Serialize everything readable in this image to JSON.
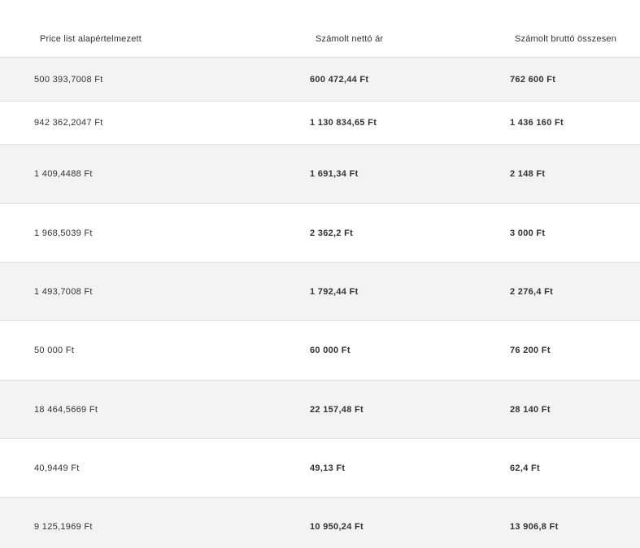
{
  "table": {
    "headers": [
      "Price list alapértelmezett",
      "Számolt nettó ár",
      "Számolt bruttó összesen"
    ],
    "rows": [
      [
        "500 393,7008 Ft",
        "600 472,44 Ft",
        "762 600 Ft"
      ],
      [
        "942 362,2047 Ft",
        "1 130 834,65 Ft",
        "1 436 160 Ft"
      ],
      [
        "1 409,4488 Ft",
        "1 691,34 Ft",
        "2 148 Ft"
      ],
      [
        "1 968,5039 Ft",
        "2 362,2 Ft",
        "3 000 Ft"
      ],
      [
        "1 493,7008 Ft",
        "1 792,44 Ft",
        "2 276,4 Ft"
      ],
      [
        "50 000 Ft",
        "60 000 Ft",
        "76 200 Ft"
      ],
      [
        "18 464,5669 Ft",
        "22 157,48 Ft",
        "28 140 Ft"
      ],
      [
        "40,9449 Ft",
        "49,13 Ft",
        "62,4 Ft"
      ],
      [
        "9 125,1969 Ft",
        "10 950,24 Ft",
        "13 906,8 Ft"
      ]
    ]
  },
  "colors": {
    "row_shade": "#f3f3f3",
    "row_plain": "#ffffff",
    "divider": "#e2e2e2",
    "text": "#333333"
  }
}
